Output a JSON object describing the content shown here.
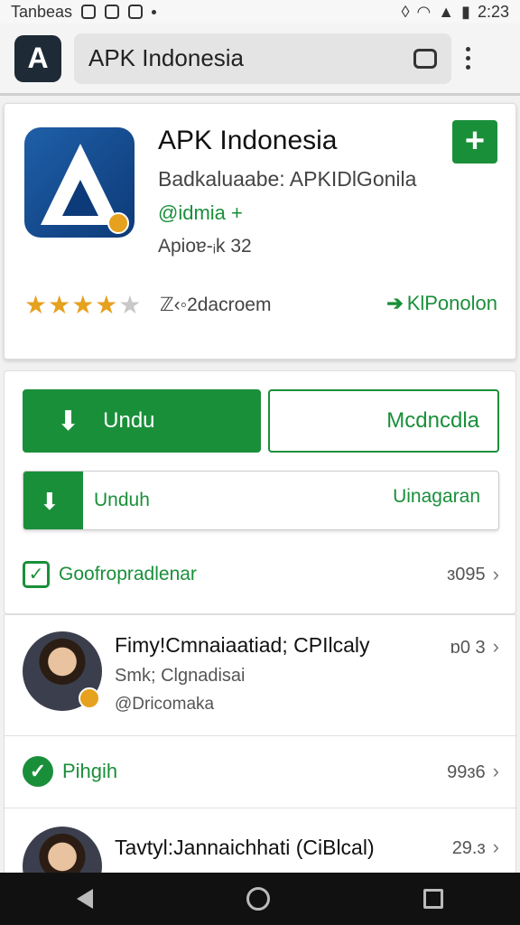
{
  "status_bar": {
    "carrier": "Tanbeas",
    "time": "2:23"
  },
  "browser": {
    "url_text": "APK Indonesia"
  },
  "app": {
    "title": "APK Indonesia",
    "developer": "Badkaluaabe: APKIDlGonila",
    "dev_link": "@idmia +",
    "version": "Apioɐ-ᵢk 32",
    "rating_value": 4.5,
    "stars": "★★★★",
    "half_star": "★",
    "downloads": "ℤ‹◦2dacroem",
    "promo_label": "KlPonolon"
  },
  "actions": {
    "primary_label": "Undu",
    "secondary_label": "Mcdncdla",
    "progress_label": "Unduh",
    "progress_right": "Uinagaran",
    "progress_fraction": 0.125
  },
  "section": {
    "label": "Goofropradlenar",
    "count": "ɜ095"
  },
  "list": [
    {
      "name": "Fimy!Cmnaiaatiad; CPIlcaly",
      "meta": "Smk; Clgnadisai",
      "handle": "@Dricomaka",
      "right": "ɒ0 3"
    },
    {
      "label": "Pihgih",
      "right": "99ɜ6"
    },
    {
      "name": "Tavtyl:Jannaichhati (CiBlcal)",
      "right": "29.ɜ"
    }
  ],
  "colors": {
    "accent": "#1a8f3a",
    "star": "#e6a11f",
    "nav": "#111111"
  }
}
